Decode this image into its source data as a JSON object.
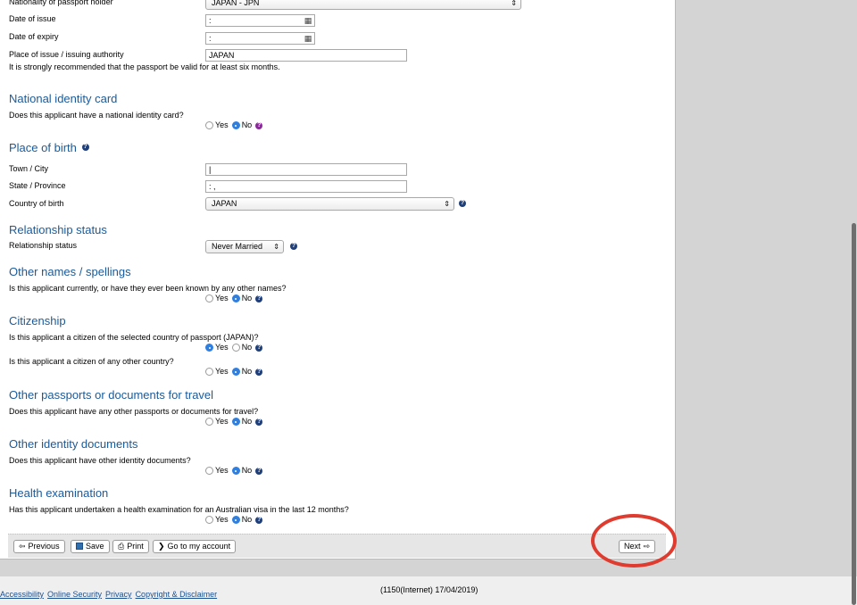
{
  "passport": {
    "nationality_label": "Nationality of passport holder",
    "nationality_value": "JAPAN - JPN",
    "date_issue_label": "Date of issue",
    "date_issue_value": ":",
    "date_expiry_label": "Date of expiry",
    "date_expiry_value": ":",
    "place_label": "Place of issue / issuing authority",
    "place_value": "JAPAN",
    "note": "It is strongly recommended that the passport be valid for at least six months."
  },
  "national_id": {
    "heading": "National identity card",
    "question": "Does this applicant have a national identity card?",
    "yes": "Yes",
    "no": "No",
    "selected": "No"
  },
  "birth": {
    "heading": "Place of birth",
    "town_label": "Town / City",
    "town_value": "|",
    "state_label": "State / Province",
    "state_value": ":   ,",
    "country_label": "Country of birth",
    "country_value": "JAPAN"
  },
  "relationship": {
    "heading": "Relationship status",
    "label": "Relationship status",
    "value": "Never Married"
  },
  "other_names": {
    "heading": "Other names / spellings",
    "question": "Is this applicant currently, or have they ever been known by any other names?",
    "yes": "Yes",
    "no": "No",
    "selected": "No"
  },
  "citizenship": {
    "heading": "Citizenship",
    "question1": "Is this applicant a citizen of the selected country of passport (JAPAN)?",
    "q1_selected": "Yes",
    "question2": "Is this applicant a citizen of any other country?",
    "q2_selected": "No",
    "yes": "Yes",
    "no": "No"
  },
  "other_passports": {
    "heading": "Other passports or documents for travel",
    "question": "Does this applicant have any other passports or documents for travel?",
    "yes": "Yes",
    "no": "No",
    "selected": "No"
  },
  "other_identity": {
    "heading": "Other identity documents",
    "question": "Does this applicant have other identity documents?",
    "yes": "Yes",
    "no": "No",
    "selected": "No"
  },
  "health": {
    "heading": "Health examination",
    "question": "Has this applicant undertaken a health examination for an Australian visa in the last 12 months?",
    "yes": "Yes",
    "no": "No",
    "selected": "No"
  },
  "toolbar": {
    "previous": "Previous",
    "save": "Save",
    "print": "Print",
    "account": "Go to my account",
    "next": "Next"
  },
  "footer": {
    "links": [
      "Accessibility",
      "Online Security",
      "Privacy",
      "Copyright & Disclaimer"
    ],
    "build": "(1150(Internet) 17/04/2019)"
  },
  "icons": {
    "help": "help-icon",
    "calendar": "calendar-icon",
    "save": "floppy-disk-icon",
    "print": "printer-icon",
    "previous": "arrow-left-icon",
    "next": "arrow-right-icon",
    "account": "chevron-right-icon"
  },
  "colors": {
    "heading": "#1a5a9a",
    "radio_selected": "#2f7fe0",
    "highlight_circle": "#e03b2f"
  }
}
